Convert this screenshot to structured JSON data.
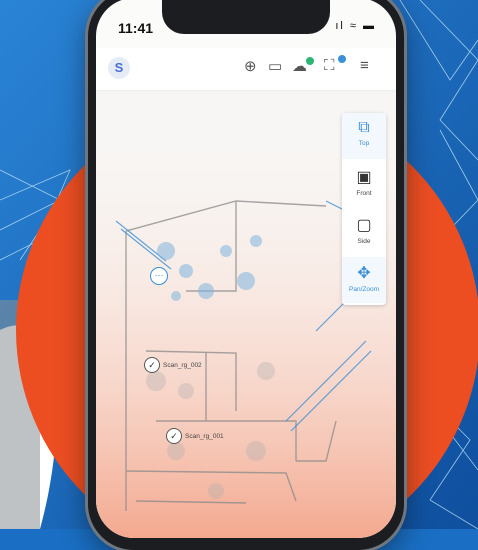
{
  "status": {
    "time": "11:41",
    "icons": "ıl ≈ ▬"
  },
  "appbar": {
    "logo": "S",
    "icons": [
      "crosshair-plus-icon",
      "battery-icon",
      "cloud-icon",
      "scanner-icon",
      "menu-icon"
    ],
    "glyphs": {
      "crosshair": "⊕",
      "battery": "▭",
      "cloud": "☁",
      "scanner": "⛶",
      "menu": "≡"
    },
    "status_dots": {
      "cloud": "#2bb673",
      "scanner": "#3a8fd6"
    }
  },
  "view_panel": {
    "buttons": [
      {
        "label": "Top",
        "glyph": "⧉",
        "active": true
      },
      {
        "label": "Front",
        "glyph": "▣",
        "active": false
      },
      {
        "label": "Side",
        "glyph": "▢",
        "active": false
      },
      {
        "label": "Pan/Zoom",
        "glyph": "✥",
        "active": true
      }
    ]
  },
  "scans": [
    {
      "name": "Scan_rg_002",
      "glyph": "✓"
    },
    {
      "name": "Scan_rg_001",
      "glyph": "✓"
    }
  ],
  "current_position": {
    "glyph": "⋯"
  },
  "colors": {
    "accent": "#3a8fd6",
    "orange": "#ec4e22",
    "blue_bg": "#1a6fc4"
  }
}
